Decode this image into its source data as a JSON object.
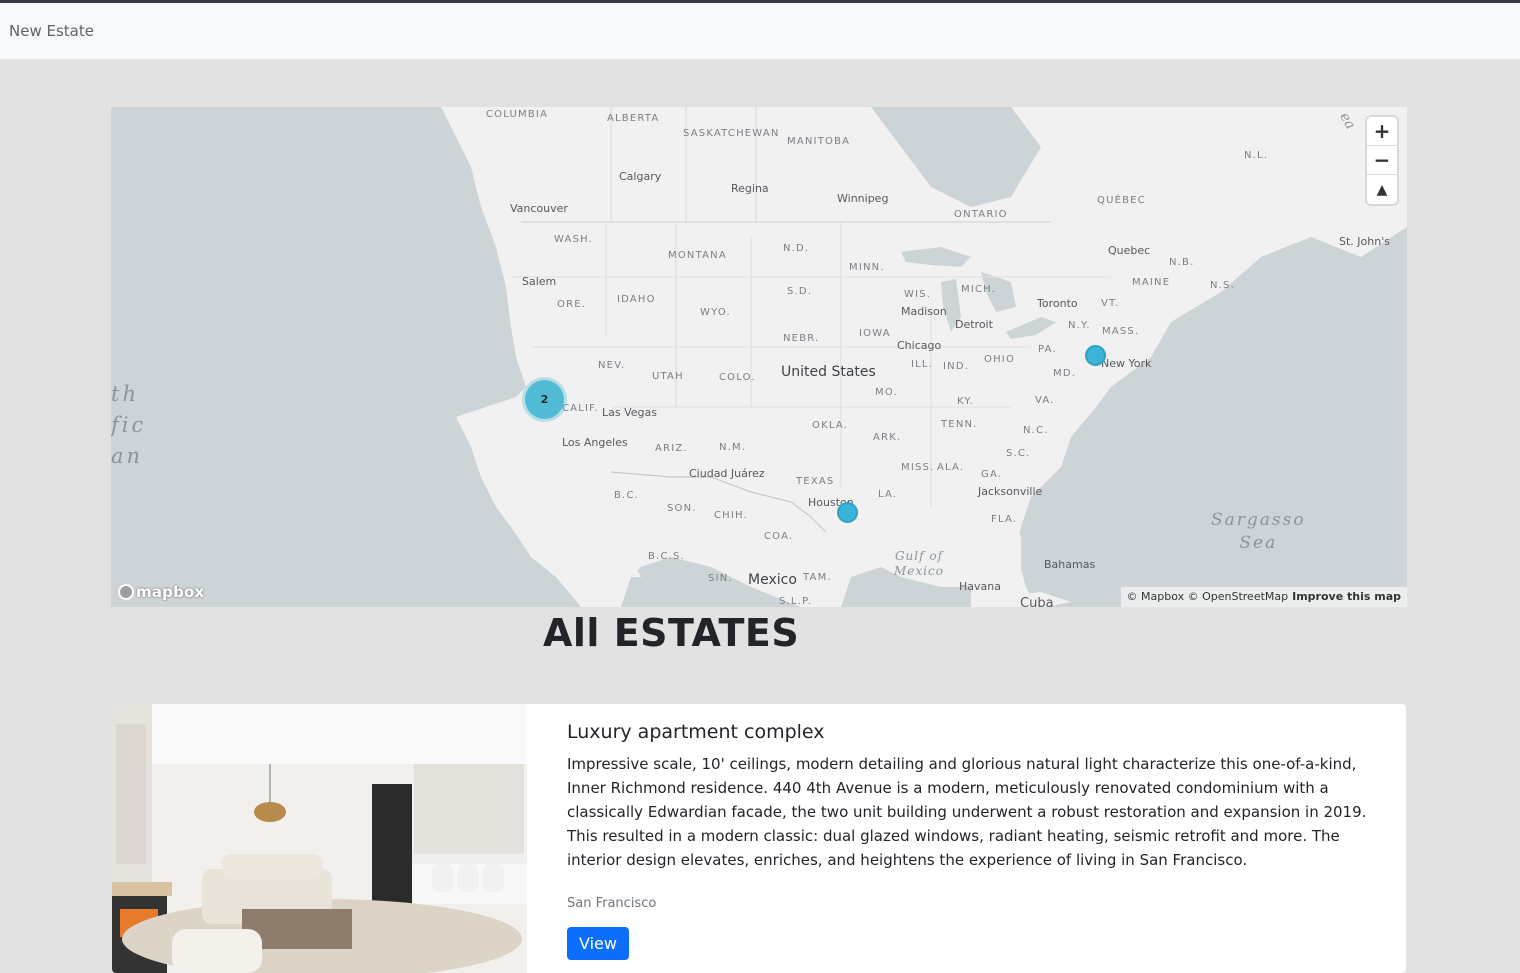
{
  "navbar": {
    "brand": "New Estate"
  },
  "map": {
    "states": [
      "COLUMBIA",
      "ALBERTA",
      "SASKATCHEWAN",
      "MANITOBA",
      "ONTARIO",
      "QUÉBEC",
      "N.L.",
      "WASH.",
      "MONTANA",
      "N.D.",
      "MINN.",
      "IDAHO",
      "ORE.",
      "WYO.",
      "S.D.",
      "WIS.",
      "MICH.",
      "N.Y.",
      "MASS.",
      "VT.",
      "MAINE",
      "N.B.",
      "N.S.",
      "NEBR.",
      "IOWA",
      "NEV.",
      "CALIF.",
      "UTAH",
      "COLO.",
      "PA.",
      "OHIO",
      "IND.",
      "ILL.",
      "MO.",
      "KY.",
      "VA.",
      "MD.",
      "ARIZ.",
      "N.M.",
      "OKLA.",
      "ARK.",
      "TENN.",
      "N.C.",
      "S.C.",
      "TEXAS",
      "MISS.",
      "ALA.",
      "GA.",
      "LA.",
      "FLA.",
      "SON.",
      "CHIH.",
      "COA.",
      "B.C.",
      "B.C.S.",
      "SIN.",
      "TAM.",
      "S.L.P."
    ],
    "cities": [
      "Calgary",
      "Regina",
      "Winnipeg",
      "Vancouver",
      "Salem",
      "Madison",
      "Detroit",
      "Toronto",
      "Chicago",
      "Quebec",
      "St. John's",
      "New York",
      "Las Vegas",
      "Los Angeles",
      "Ciudad Juárez",
      "Houston",
      "Jacksonville",
      "Havana",
      "Bahamas",
      "Cuba"
    ],
    "country_us": "United States",
    "country_mx": "Mexico",
    "water_pacific": "th\nfic\nan",
    "water_sargasso": "Sargasso\nSea",
    "water_gulf": "Gulf of\nMexico",
    "water_sea_corner": "ea",
    "markers": [
      {
        "label": "2",
        "kind": "cluster"
      },
      {
        "label": "",
        "kind": "point"
      },
      {
        "label": "",
        "kind": "point"
      }
    ],
    "controls": {
      "zoom_in": "+",
      "zoom_out": "−",
      "compass": "▲"
    },
    "logo": "mapbox",
    "attribution": "© Mapbox © OpenStreetMap",
    "improve": "Improve this map"
  },
  "page": {
    "heading": "All ESTATES"
  },
  "listing": {
    "title": "Luxury apartment complex",
    "description": "Impressive scale, 10' ceilings, modern detailing and glorious natural light characterize this one-of-a-kind, Inner Richmond residence. 440 4th Avenue is a modern, meticulously renovated condominium with a classically Edwardian facade, the two unit building underwent a robust restoration and expansion in 2019. This resulted in a modern classic: dual glazed windows, radiant heating, seismic retrofit and more. The interior design elevates, enriches, and heightens the experience of living in San Francisco.",
    "location": "San Francisco",
    "button": "View"
  },
  "colors": {
    "accent": "#0d6efd",
    "marker": "#3cb3d8",
    "background": "#e2e2e2"
  }
}
